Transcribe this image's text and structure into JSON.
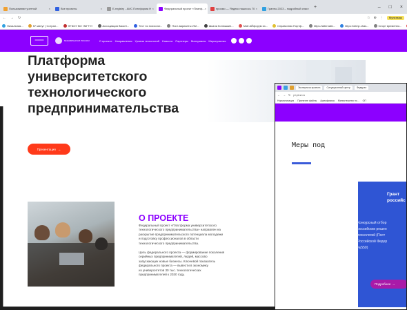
{
  "main_window": {
    "tabs": [
      {
        "label": "Пользование учетной",
        "color": "#f0a030",
        "active": false
      },
      {
        "label": "Все проекты",
        "color": "#3060e0",
        "active": false
      },
      {
        "label": "E-registry - АИС Платформа Н",
        "color": "#999999",
        "active": false
      },
      {
        "label": "Федеральный проект «Платф...",
        "color": "#8c00ff",
        "active": true
      },
      {
        "label": "просмо — Яндекс нашлось 70",
        "color": "#e04040",
        "active": false
      },
      {
        "label": "Гранты 2023 – подробный спис",
        "color": "#30a0e0",
        "active": false
      }
    ],
    "newtab_label": "+",
    "window_controls": [
      "–",
      "□",
      "×"
    ],
    "address_icons": [
      "☆",
      "⊕",
      "⋮"
    ],
    "address_pill": "Мультиакк",
    "bookmarks": [
      {
        "label": "Начальная...",
        "color": "#30a0e0"
      },
      {
        "label": "57 минут | Сотрал...",
        "color": "#e0a030"
      },
      {
        "label": "ФГБОУ ВО «МГТУ»",
        "color": "#c03030"
      },
      {
        "label": "Ассоциация баскет...",
        "color": "#606060"
      },
      {
        "label": "Тест по психолог...",
        "color": "#3060e0"
      },
      {
        "label": "Пост-варианты 202...",
        "color": "#808080"
      },
      {
        "label": "Шкала Колюшкин...",
        "color": "#404040"
      },
      {
        "label": "Мой АЙфорум из...",
        "color": "#e05050"
      },
      {
        "label": "Справочник Портф...",
        "color": "#e0c030"
      },
      {
        "label": "https://alternativ...",
        "color": "#808080"
      },
      {
        "label": "https://olimp.chas...",
        "color": "#3080e0"
      },
      {
        "label": "Спорт временно...",
        "color": "#808080"
      },
      {
        "label": "Яндекс",
        "color": "#e04040"
      }
    ],
    "site_nav": {
      "logo_text": "═══",
      "gov_text": "МИНОБРНАУКИ РОССИИ",
      "links": [
        "О проекте",
        "Направления",
        "Уровни технологий",
        "Новости",
        "Партнеры",
        "Материалы",
        "Мероприятия"
      ]
    },
    "hero": {
      "title_lines": [
        "Платформа",
        "университетского",
        "технологического",
        "предпринимательства"
      ],
      "button_label": "Презентация",
      "button_arrow": "→",
      "button_color": "#ff3a1a"
    },
    "about": {
      "title": "О ПРОЕКТЕ",
      "paragraph1": [
        "Федеральный проект «Платформа университетского",
        "технологического предпринимательства» направлен на",
        "раскрытие предпринимательского потенциала молодежи",
        "и подготовку профессионалов в области",
        "технологического предпринимательства."
      ],
      "paragraph2": [
        "Цель федерального проекта — формирование поколения",
        "серийных предпринимателей, людей, массово",
        "запускающих новые бизнесы. Ключевой показатель",
        "федерального проекта — вывести в экономику",
        "из университетов 30 тыс. технологических",
        "предпринимателей к 2030 году."
      ]
    },
    "accent_color": "#8c00ff"
  },
  "right_window": {
    "tabs": [
      "Экспертиза проекта",
      "Ситуационный центр",
      "Федерал"
    ],
    "address": "pl.pt-st.ru",
    "bookmarks": [
      "Нормализация",
      "Принятие файлы",
      "Армофизика",
      "Министерство по...",
      "ОП"
    ],
    "heading": "Меры под",
    "card": {
      "title_lines": [
        "Грант",
        "российс"
      ],
      "desc_lines": [
        "Конкурсный отбор",
        "российских решен",
        "технологий (Пост",
        "Российской Федер",
        "№550)"
      ],
      "button_label": "Подробнее",
      "button_arrow": "→"
    },
    "card_color": "#2f55d4"
  }
}
